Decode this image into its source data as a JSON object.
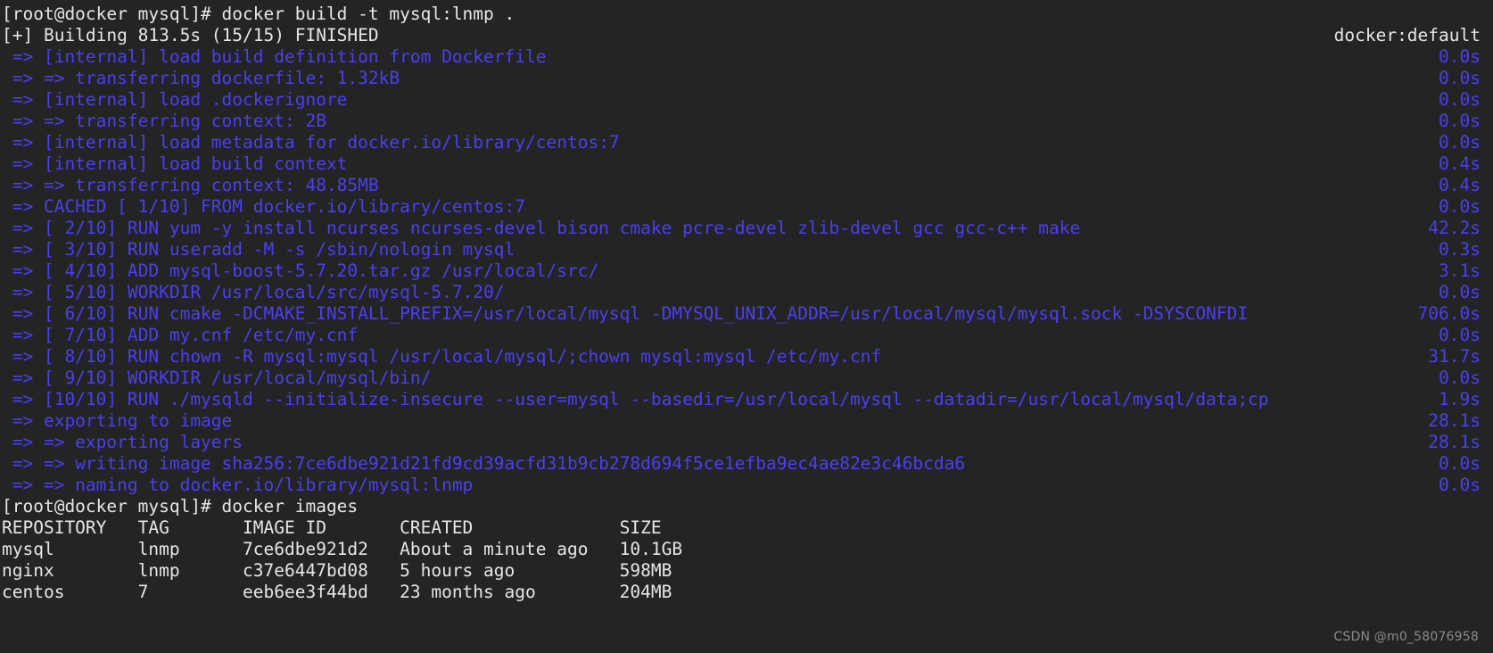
{
  "terminal": {
    "background_color": "#242424",
    "prompt_color": "#e6e6e6",
    "build_color": "#4b3ff0",
    "watermark_color": "#8b8b8b",
    "watermark": "CSDN @m0_58076958"
  },
  "lines": [
    {
      "kind": "prompt",
      "text": "[root@docker mysql]# docker build -t mysql:lnmp .",
      "right": "",
      "right_style": ""
    },
    {
      "kind": "prompt",
      "text": "[+] Building 813.5s (15/15) FINISHED",
      "right": "docker:default",
      "right_style": "white"
    },
    {
      "kind": "build",
      "text": " => [internal] load build definition from Dockerfile",
      "right": "0.0s",
      "right_style": "blue"
    },
    {
      "kind": "build",
      "text": " => => transferring dockerfile: 1.32kB",
      "right": "0.0s",
      "right_style": "blue"
    },
    {
      "kind": "build",
      "text": " => [internal] load .dockerignore",
      "right": "0.0s",
      "right_style": "blue"
    },
    {
      "kind": "build",
      "text": " => => transferring context: 2B",
      "right": "0.0s",
      "right_style": "blue"
    },
    {
      "kind": "build",
      "text": " => [internal] load metadata for docker.io/library/centos:7",
      "right": "0.0s",
      "right_style": "blue"
    },
    {
      "kind": "build",
      "text": " => [internal] load build context",
      "right": "0.4s",
      "right_style": "blue"
    },
    {
      "kind": "build",
      "text": " => => transferring context: 48.85MB",
      "right": "0.4s",
      "right_style": "blue"
    },
    {
      "kind": "build",
      "text": " => CACHED [ 1/10] FROM docker.io/library/centos:7",
      "right": "0.0s",
      "right_style": "blue"
    },
    {
      "kind": "build",
      "text": " => [ 2/10] RUN yum -y install ncurses ncurses-devel bison cmake pcre-devel zlib-devel gcc gcc-c++ make",
      "right": "42.2s",
      "right_style": "blue"
    },
    {
      "kind": "build",
      "text": " => [ 3/10] RUN useradd -M -s /sbin/nologin mysql",
      "right": "0.3s",
      "right_style": "blue"
    },
    {
      "kind": "build",
      "text": " => [ 4/10] ADD mysql-boost-5.7.20.tar.gz /usr/local/src/",
      "right": "3.1s",
      "right_style": "blue"
    },
    {
      "kind": "build",
      "text": " => [ 5/10] WORKDIR /usr/local/src/mysql-5.7.20/",
      "right": "0.0s",
      "right_style": "blue"
    },
    {
      "kind": "build",
      "text": " => [ 6/10] RUN cmake -DCMAKE_INSTALL_PREFIX=/usr/local/mysql -DMYSQL_UNIX_ADDR=/usr/local/mysql/mysql.sock -DSYSCONFDI",
      "right": "706.0s",
      "right_style": "blue"
    },
    {
      "kind": "build",
      "text": " => [ 7/10] ADD my.cnf /etc/my.cnf",
      "right": "0.0s",
      "right_style": "blue"
    },
    {
      "kind": "build",
      "text": " => [ 8/10] RUN chown -R mysql:mysql /usr/local/mysql/;chown mysql:mysql /etc/my.cnf",
      "right": "31.7s",
      "right_style": "blue"
    },
    {
      "kind": "build",
      "text": " => [ 9/10] WORKDIR /usr/local/mysql/bin/",
      "right": "0.0s",
      "right_style": "blue"
    },
    {
      "kind": "build",
      "text": " => [10/10] RUN ./mysqld --initialize-insecure --user=mysql --basedir=/usr/local/mysql --datadir=/usr/local/mysql/data;cp",
      "right": "1.9s",
      "right_style": "blue"
    },
    {
      "kind": "build",
      "text": " => exporting to image",
      "right": "28.1s",
      "right_style": "blue"
    },
    {
      "kind": "build",
      "text": " => => exporting layers",
      "right": "28.1s",
      "right_style": "blue"
    },
    {
      "kind": "build",
      "text": " => => writing image sha256:7ce6dbe921d21fd9cd39acfd31b9cb278d694f5ce1efba9ec4ae82e3c46bcda6",
      "right": "0.0s",
      "right_style": "blue"
    },
    {
      "kind": "build",
      "text": " => => naming to docker.io/library/mysql:lnmp",
      "right": "0.0s",
      "right_style": "blue"
    },
    {
      "kind": "prompt",
      "text": "[root@docker mysql]# docker images",
      "right": "",
      "right_style": ""
    },
    {
      "kind": "table",
      "text": "REPOSITORY   TAG       IMAGE ID       CREATED              SIZE",
      "right": "",
      "right_style": ""
    },
    {
      "kind": "table",
      "text": "mysql        lnmp      7ce6dbe921d2   About a minute ago   10.1GB",
      "right": "",
      "right_style": ""
    },
    {
      "kind": "table",
      "text": "nginx        lnmp      c37e6447bd08   5 hours ago          598MB",
      "right": "",
      "right_style": ""
    },
    {
      "kind": "table",
      "text": "centos       7         eeb6ee3f44bd   23 months ago        204MB",
      "right": "",
      "right_style": ""
    }
  ]
}
